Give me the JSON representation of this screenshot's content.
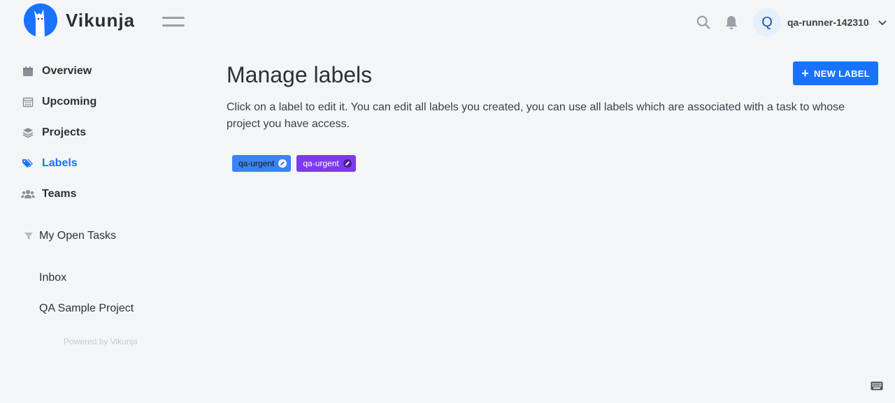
{
  "header": {
    "app_name": "Vikunja",
    "user": {
      "avatar_letter": "Q",
      "username": "qa-runner-142310"
    }
  },
  "sidebar": {
    "items": [
      {
        "label": "Overview",
        "icon": "calendar-icon",
        "active": false
      },
      {
        "label": "Upcoming",
        "icon": "calendar-grid-icon",
        "active": false
      },
      {
        "label": "Projects",
        "icon": "layers-icon",
        "active": false
      },
      {
        "label": "Labels",
        "icon": "tags-icon",
        "active": true
      },
      {
        "label": "Teams",
        "icon": "users-icon",
        "active": false
      }
    ],
    "saved_filter": {
      "label": "My Open Tasks",
      "icon": "filter-icon"
    },
    "projects": [
      "Inbox",
      "QA Sample Project"
    ],
    "powered_by": "Powered by Vikunja"
  },
  "main": {
    "title": "Manage labels",
    "new_label_button": "NEW LABEL",
    "help_text": "Click on a label to edit it. You can edit all labels you created, you can use all labels which are associated with a task to whose project you have access.",
    "labels": [
      {
        "name": "qa-urgent",
        "bg": "#3b82f6",
        "fg": "#1a1a1a"
      },
      {
        "name": "qa-urgent",
        "bg": "#7c3aed",
        "fg": "#ffffff"
      }
    ]
  },
  "colors": {
    "primary": "#1973ff",
    "background": "#f4f5f7"
  }
}
